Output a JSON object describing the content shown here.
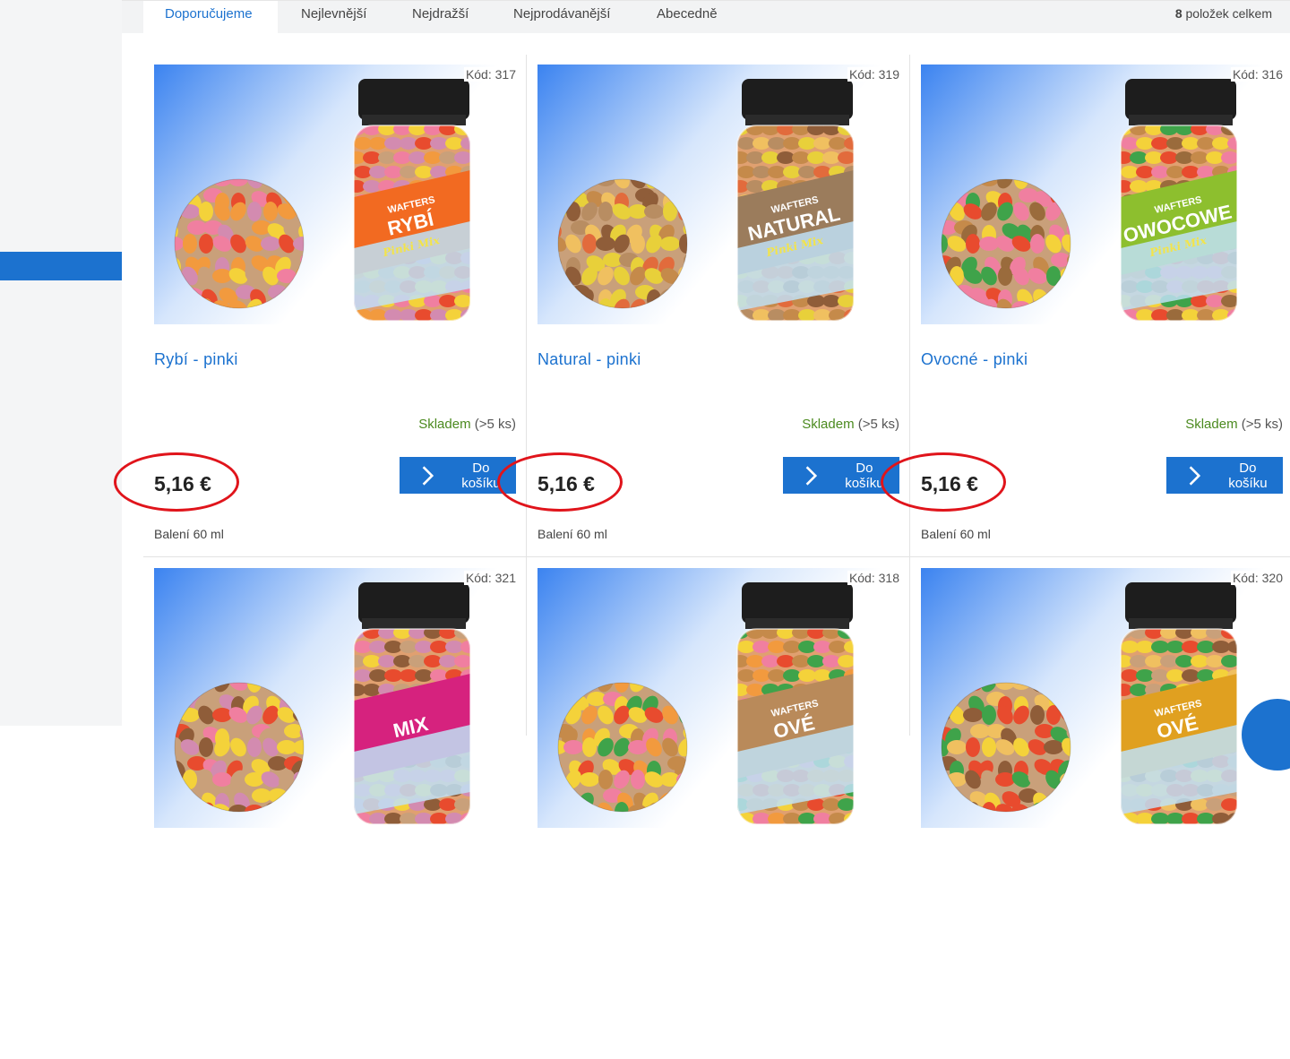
{
  "tabs": [
    "Doporučujeme",
    "Nejlevnější",
    "Nejdražší",
    "Nejprodávanější",
    "Abecedně"
  ],
  "count": {
    "number": "8",
    "label": "položek celkem"
  },
  "products": [
    {
      "code": "Kód: 317",
      "name": "Rybí - pinki",
      "stock_status": "Skladem",
      "stock_qty": "(>5 ks)",
      "price": "5,16 €",
      "cart": "Do košíku",
      "pack": "Balení 60 ml",
      "label_top": "WAFTERS",
      "label_main": "RYBÍ",
      "label_sub": "Pinki Mix",
      "label_color": "#f26a21",
      "pellet_colors": [
        "#e84b2e",
        "#f4d23a",
        "#d38bb0",
        "#f29a3e",
        "#c9a07a",
        "#f07fa0"
      ]
    },
    {
      "code": "Kód: 319",
      "name": "Natural - pinki",
      "stock_status": "Skladem",
      "stock_qty": "(>5 ks)",
      "price": "5,16 €",
      "cart": "Do košíku",
      "pack": "Balení 60 ml",
      "label_top": "WAFTERS",
      "label_main": "NATURAL",
      "label_sub": "Pinki Mix",
      "label_color": "#9b7c5c",
      "pellet_colors": [
        "#e8d03a",
        "#c58a4a",
        "#8f5d39",
        "#e26b3c",
        "#b88d62",
        "#f0c060"
      ]
    },
    {
      "code": "Kód: 316",
      "name": "Ovocné - pinki",
      "stock_status": "Skladem",
      "stock_qty": "(>5 ks)",
      "price": "5,16 €",
      "cart": "Do košíku",
      "pack": "Balení 60 ml",
      "label_top": "WAFTERS",
      "label_main": "OWOCOWE",
      "label_sub": "Pinki Mix",
      "label_color": "#8dbf2e",
      "pellet_colors": [
        "#e84b2e",
        "#f4d23a",
        "#3fa34a",
        "#c58a4a",
        "#f07fa0",
        "#9a6b3c"
      ]
    },
    {
      "code": "Kód: 321",
      "name": "",
      "label_top": "",
      "label_main": "MIX",
      "label_color": "#d6227e",
      "pellet_colors": [
        "#e84b2e",
        "#f4d23a",
        "#d38bb0",
        "#8f5d39",
        "#c9a07a",
        "#f07fa0"
      ]
    },
    {
      "code": "Kód: 318",
      "name": "",
      "label_top": "WAFTERS",
      "label_main": "OVÉ",
      "label_color": "#b98a5a",
      "pellet_colors": [
        "#f4d23a",
        "#e84b2e",
        "#c58a4a",
        "#3fa34a",
        "#f07fa0",
        "#f29a3e"
      ]
    },
    {
      "code": "Kód: 320",
      "name": "",
      "label_top": "WAFTERS",
      "label_main": "OVÉ",
      "label_color": "#e0a020",
      "pellet_colors": [
        "#f4d23a",
        "#3fa34a",
        "#8f5d39",
        "#e84b2e",
        "#c9a07a",
        "#f0c060"
      ]
    }
  ]
}
